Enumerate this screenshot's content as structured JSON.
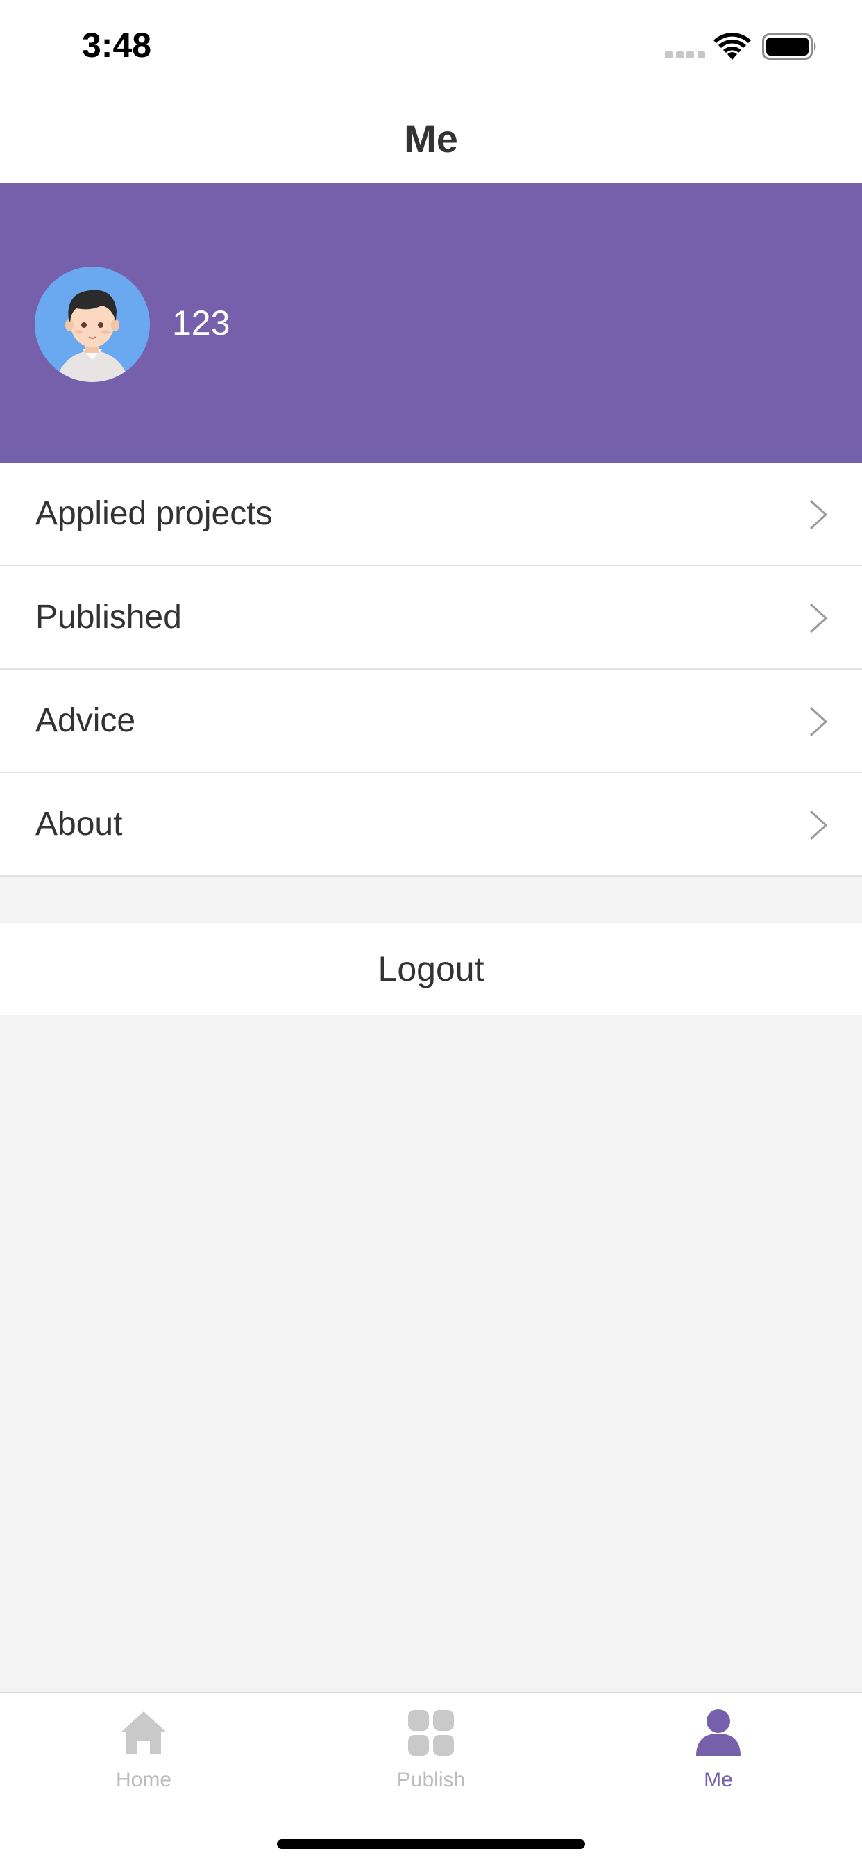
{
  "status_bar": {
    "time": "3:48",
    "icons": [
      "cellular-signal-icon",
      "wifi-icon",
      "battery-icon"
    ]
  },
  "nav": {
    "title": "Me"
  },
  "profile": {
    "avatar_icon": "user-avatar-illustration",
    "username": "123",
    "banner_color": "#7660ab"
  },
  "menu": {
    "items": [
      {
        "label": "Applied projects",
        "icon": "chevron-right-icon"
      },
      {
        "label": "Published",
        "icon": "chevron-right-icon"
      },
      {
        "label": "Advice",
        "icon": "chevron-right-icon"
      },
      {
        "label": "About",
        "icon": "chevron-right-icon"
      }
    ]
  },
  "logout": {
    "label": "Logout"
  },
  "tab_bar": {
    "active": "Me",
    "accent_color": "#7660ab",
    "inactive_color": "#bcbcbc",
    "tabs": [
      {
        "label": "Home",
        "icon": "home-icon"
      },
      {
        "label": "Publish",
        "icon": "grid-icon"
      },
      {
        "label": "Me",
        "icon": "person-icon"
      }
    ]
  }
}
